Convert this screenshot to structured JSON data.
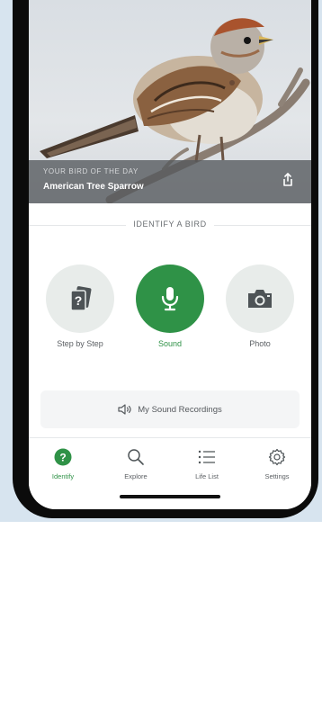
{
  "hero": {
    "kicker": "YOUR BIRD OF THE DAY",
    "title": "American Tree Sparrow",
    "share_icon": "share-icon"
  },
  "identify": {
    "heading": "IDENTIFY A BIRD",
    "options": [
      {
        "label": "Step by Step",
        "icon": "cards-question-icon",
        "active": false
      },
      {
        "label": "Sound",
        "icon": "microphone-icon",
        "active": true
      },
      {
        "label": "Photo",
        "icon": "camera-icon",
        "active": false
      }
    ],
    "recordings_label": "My Sound Recordings",
    "recordings_icon": "speaker-icon"
  },
  "tabbar": {
    "tabs": [
      {
        "label": "Identify",
        "icon": "question-circle-icon",
        "active": true
      },
      {
        "label": "Explore",
        "icon": "search-icon",
        "active": false
      },
      {
        "label": "Life List",
        "icon": "list-icon",
        "active": false
      },
      {
        "label": "Settings",
        "icon": "gear-icon",
        "active": false
      }
    ]
  },
  "colors": {
    "accent": "#2f9247",
    "circle_bg": "#e8ecea",
    "text_muted": "#5c6064"
  }
}
